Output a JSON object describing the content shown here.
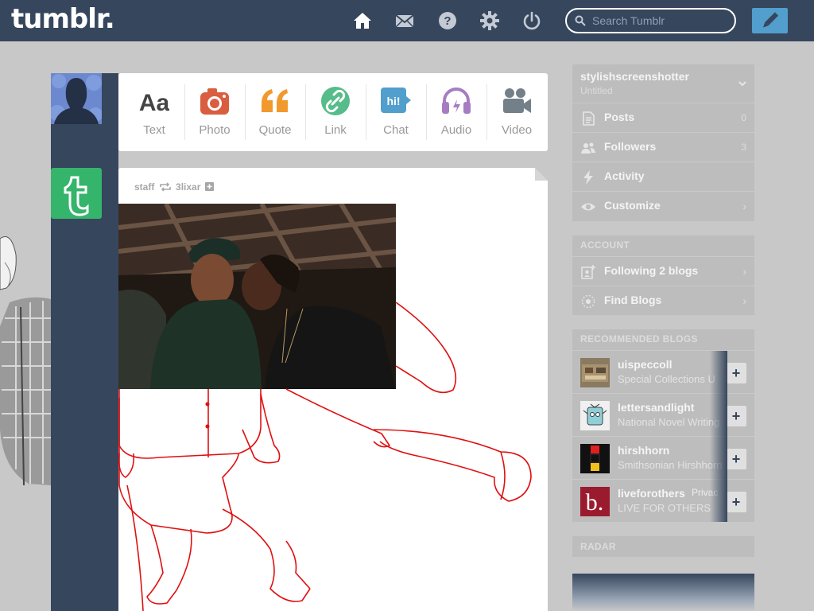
{
  "header": {
    "logo": "tumblr.",
    "search_placeholder": "Search Tumblr",
    "nav": [
      "home-icon",
      "mail-icon",
      "help-icon",
      "gear-icon",
      "power-icon"
    ]
  },
  "post_types": [
    {
      "label": "Text",
      "icon": "text-icon",
      "color": "#444444"
    },
    {
      "label": "Photo",
      "icon": "camera-icon",
      "color": "#d95e40"
    },
    {
      "label": "Quote",
      "icon": "quote-icon",
      "color": "#f2992e"
    },
    {
      "label": "Link",
      "icon": "link-icon",
      "color": "#56bc8a"
    },
    {
      "label": "Chat",
      "icon": "chat-icon",
      "color": "#529ecc"
    },
    {
      "label": "Audio",
      "icon": "headphones-icon",
      "color": "#a77dc2"
    },
    {
      "label": "Video",
      "icon": "video-camera-icon",
      "color": "#748089"
    }
  ],
  "post": {
    "author": "staff",
    "reblogged_from": "3lixar"
  },
  "account_panel": {
    "username": "stylishscreenshotter",
    "subtitle": "Untitled",
    "rows": [
      {
        "label": "Posts",
        "count": "0",
        "icon": "posts-icon"
      },
      {
        "label": "Followers",
        "count": "3",
        "icon": "followers-icon"
      },
      {
        "label": "Activity",
        "count": "",
        "icon": "lightning-icon"
      },
      {
        "label": "Customize",
        "count": "",
        "icon": "eye-icon"
      }
    ]
  },
  "account_section": {
    "heading": "ACCOUNT",
    "rows": [
      {
        "label": "Following 2 blogs",
        "icon": "following-icon"
      },
      {
        "label": "Find Blogs",
        "icon": "compass-icon"
      }
    ]
  },
  "recommended": {
    "heading": "RECOMMENDED BLOGS",
    "blogs": [
      {
        "name": "uispeccoll",
        "desc": "Special Collections U"
      },
      {
        "name": "lettersandlight",
        "desc": "National Novel Writing"
      },
      {
        "name": "hirshhorn",
        "desc": "Smithsonian Hirshhorn"
      },
      {
        "name": "liveforothers",
        "desc": "LIVE FOR OTHERS",
        "overlay": "Privac"
      }
    ],
    "follow_symbol": "+"
  },
  "radar": {
    "heading": "RADAR"
  },
  "colors": {
    "header_bg": "#36465d",
    "page_bg": "#c8c8c8",
    "accent": "#529ecc",
    "doodle": "#e01010"
  }
}
